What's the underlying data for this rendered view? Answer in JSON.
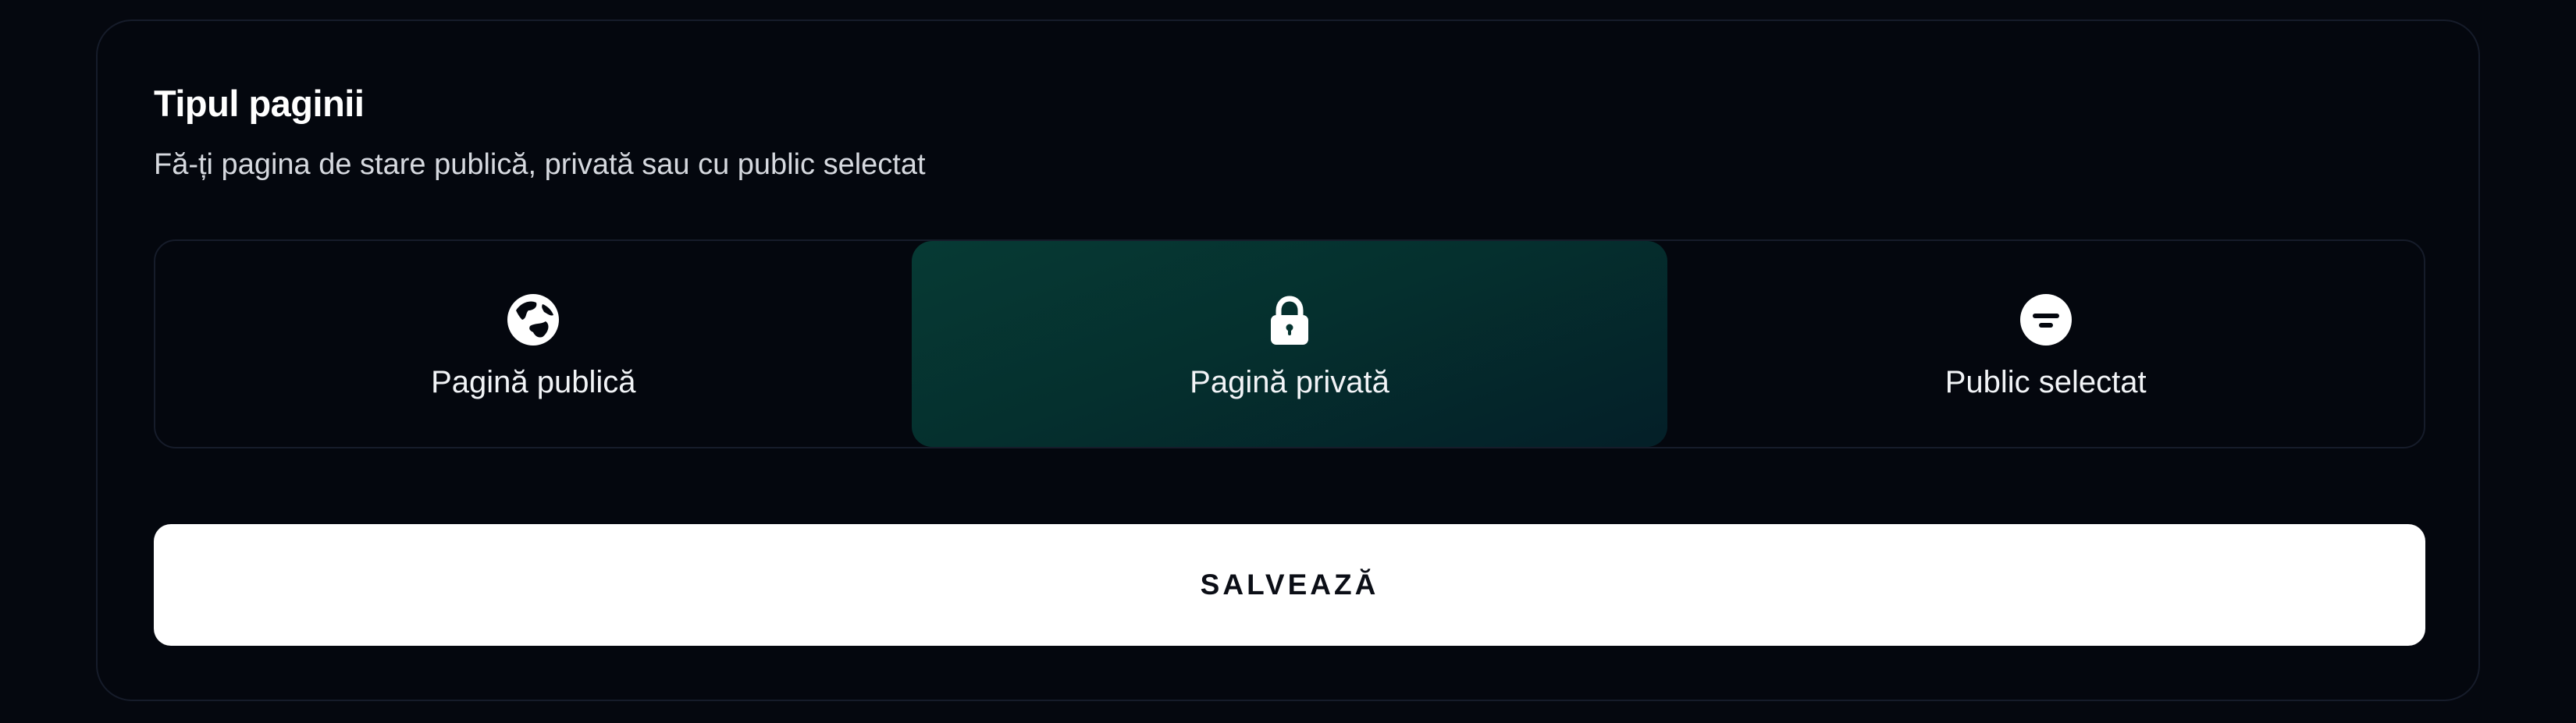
{
  "section": {
    "title": "Tipul paginii",
    "subtitle": "Fă-ți pagina de stare publică, privată sau cu public selectat"
  },
  "options": [
    {
      "label": "Pagină publică",
      "icon": "globe-icon",
      "selected": false
    },
    {
      "label": "Pagină privată",
      "icon": "lock-icon",
      "selected": true
    },
    {
      "label": "Public selectat",
      "icon": "filter-icon",
      "selected": false
    }
  ],
  "actions": {
    "save_label": "SALVEAZĂ"
  },
  "colors": {
    "background": "#05080f",
    "selected_segment": "#053430",
    "button_background": "#ffffff",
    "button_text": "#0b0e16"
  }
}
